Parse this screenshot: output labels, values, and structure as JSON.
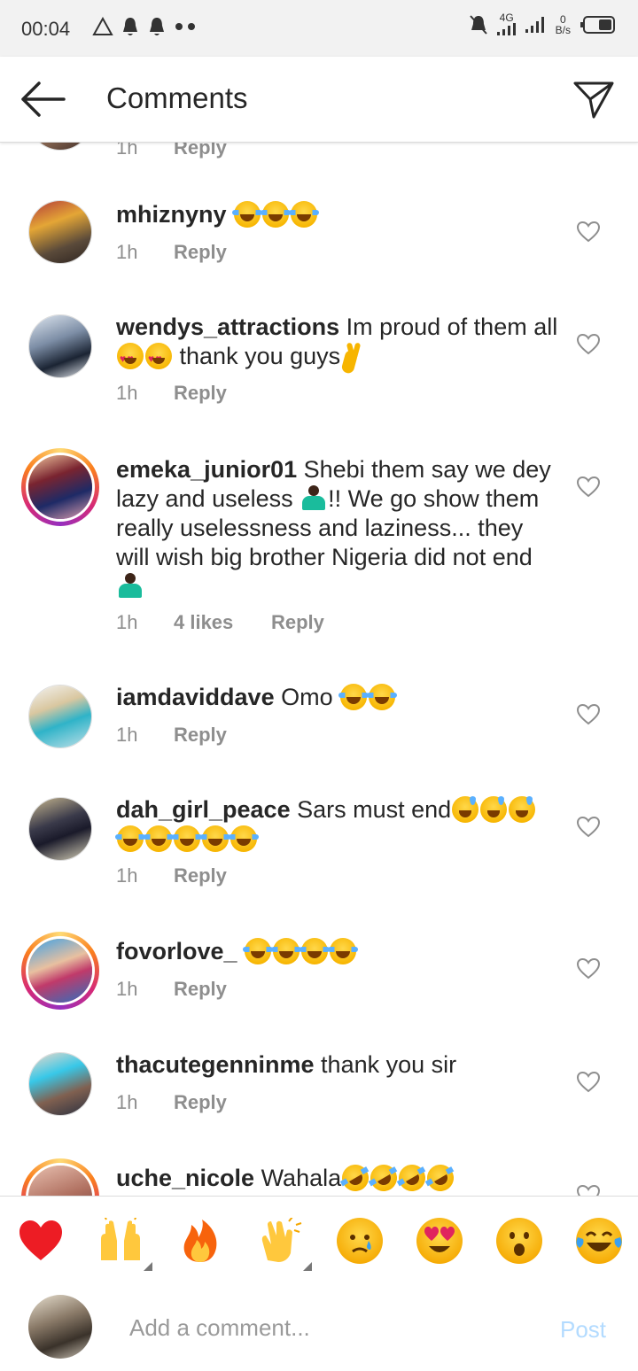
{
  "status_bar": {
    "time": "00:04",
    "network": "4G",
    "speed_value": "0",
    "speed_unit": "B/s"
  },
  "header": {
    "title": "Comments"
  },
  "partial_top": {
    "time": "1h",
    "reply": "Reply"
  },
  "comments": [
    {
      "username": "mhiznyny",
      "text": "",
      "emojis": [
        "laugh",
        "laugh",
        "laugh"
      ],
      "time": "1h",
      "likes": "",
      "reply": "Reply"
    },
    {
      "username": "wendys_attractions",
      "text": "Im proud of them all",
      "text2": "thank you guys",
      "time": "1h",
      "likes": "",
      "reply": "Reply"
    },
    {
      "username": "emeka_junior01",
      "text": "Shebi them say we dey lazy and useless",
      "text2": "!! We go show them really uselessness and laziness... they will wish big brother Nigeria did not end",
      "time": "1h",
      "likes": "4 likes",
      "reply": "Reply"
    },
    {
      "username": "iamdaviddave",
      "text": "Omo",
      "time": "1h",
      "likes": "",
      "reply": "Reply"
    },
    {
      "username": "dah_girl_peace",
      "text": "Sars must end",
      "time": "1h",
      "likes": "",
      "reply": "Reply"
    },
    {
      "username": "fovorlove_",
      "text": "",
      "time": "1h",
      "likes": "",
      "reply": "Reply"
    },
    {
      "username": "thacutegenninme",
      "text": "thank you sir",
      "time": "1h",
      "likes": "",
      "reply": "Reply"
    },
    {
      "username": "uche_nicole",
      "text": "Wahala",
      "time": "",
      "likes": "",
      "reply": ""
    }
  ],
  "reactions": [
    "red-heart",
    "raised-hands",
    "fire",
    "clapping-hands",
    "crying-face",
    "heart-eyes",
    "surprised-face",
    "tears-of-joy"
  ],
  "composer": {
    "placeholder": "Add a comment...",
    "post_label": "Post"
  },
  "colors": {
    "link_blue": "#b3dbff",
    "text": "#262626",
    "meta_gray": "#8e8e8e",
    "heart_red": "#ed1c24"
  }
}
